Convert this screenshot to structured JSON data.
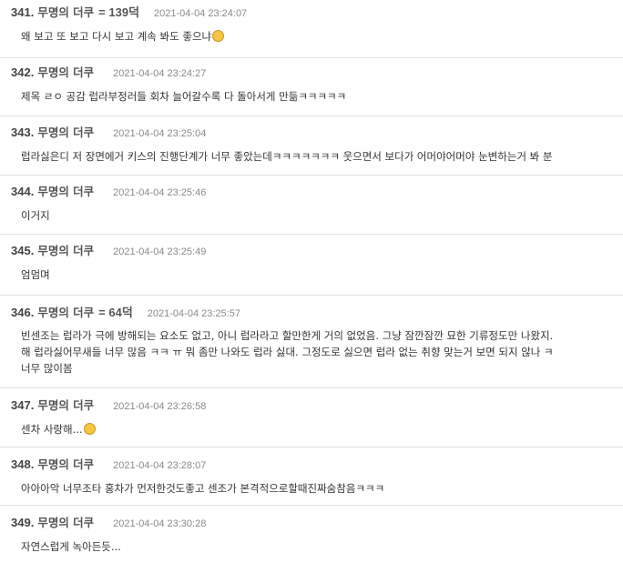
{
  "posts": [
    {
      "number": "341.",
      "name": "무명의 더쿠",
      "badge": "= 139덕",
      "date": "2021-04-04 23:24:07",
      "lines": [
        "왜 보고 또 보고 다시 보고 계속 봐도 좋으냐"
      ],
      "emoji": "blushing-face-emoji"
    },
    {
      "number": "342.",
      "name": "무명의 더쿠",
      "badge": "",
      "date": "2021-04-04 23:24:27",
      "lines": [
        "제목 ㄹㅇ 공감 럽라부정러들 회차 늘어갈수록 다 돌아서게 만듦ㅋㅋㅋㅋㅋ"
      ]
    },
    {
      "number": "343.",
      "name": "무명의 더쿠",
      "badge": "",
      "date": "2021-04-04 23:25:04",
      "lines": [
        "럽라싫은디 저 장면에거 키스의 진행단계가 너무 좋았는데ㅋㅋㅋㅋㅋㅋㅋ 웃으면서 보다가 어머야어머야 눈변하는거 봐 분"
      ]
    },
    {
      "number": "344.",
      "name": "무명의 더쿠",
      "badge": "",
      "date": "2021-04-04 23:25:46",
      "lines": [
        "이거지"
      ]
    },
    {
      "number": "345.",
      "name": "무명의 더쿠",
      "badge": "",
      "date": "2021-04-04 23:25:49",
      "lines": [
        "엄멈며"
      ]
    },
    {
      "number": "346.",
      "name": "무명의 더쿠",
      "badge": "= 64덕",
      "date": "2021-04-04 23:25:57",
      "lines": [
        "빈센조는 럽라가 극에 방해되는 요소도 없고, 아니 럽라라고 할만한게 거의 없었음. 그냥 잠깐잠깐 묘한 기류정도만 나왔지.",
        "해 럽라싫어무새들 너무 많음 ㅋㅋ ㅠ 뭐 좀만 나와도 럽라 싫대. 그정도로 싫으면 럽라 없는 취향 맞는거 보면 되지 않나 ㅋ",
        "너무 많이봄"
      ]
    },
    {
      "number": "347.",
      "name": "무명의 더쿠",
      "badge": "",
      "date": "2021-04-04 23:26:58",
      "lines": [
        "센차 사랑해..."
      ],
      "emoji": "smiling-face-emoji"
    },
    {
      "number": "348.",
      "name": "무명의 더쿠",
      "badge": "",
      "date": "2021-04-04 23:28:07",
      "lines": [
        "아아아악 너무조타 홍차가 먼저한것도좋고 센조가 본격적으로할때진짜숨참음ㅋㅋㅋ"
      ]
    },
    {
      "number": "349.",
      "name": "무명의 더쿠",
      "badge": "",
      "date": "2021-04-04 23:30:28",
      "lines": [
        "자연스럽게 녹아든듯..."
      ]
    }
  ]
}
